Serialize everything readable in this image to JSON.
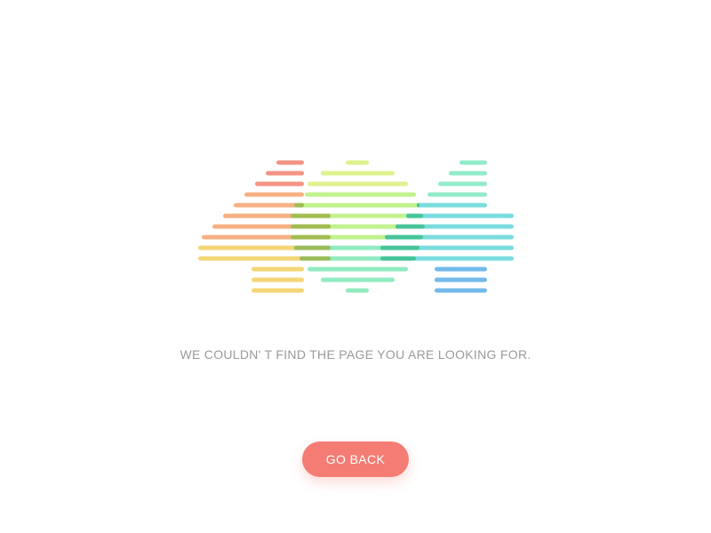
{
  "error_graphic": {
    "label": "404",
    "colors": {
      "four_left_top": "#f28b7a",
      "four_left_mid": "#f5a97a",
      "four_left_bottom": "#f2d36a",
      "zero_top": "#d8f07a",
      "zero_mid": "#b7f07a",
      "zero_bottom": "#7de7b6",
      "four_right_top": "#7fe8c0",
      "four_right_mid": "#64d6d8",
      "four_right_bottom": "#5aaee8",
      "overlap_left": "#9bb54a",
      "overlap_right": "#3fbf8f"
    }
  },
  "message": {
    "text": "WE COULDN' T FIND THE PAGE YOU ARE LOOKING FOR."
  },
  "actions": {
    "go_back_label": "GO BACK",
    "accent": "#f47c74"
  }
}
